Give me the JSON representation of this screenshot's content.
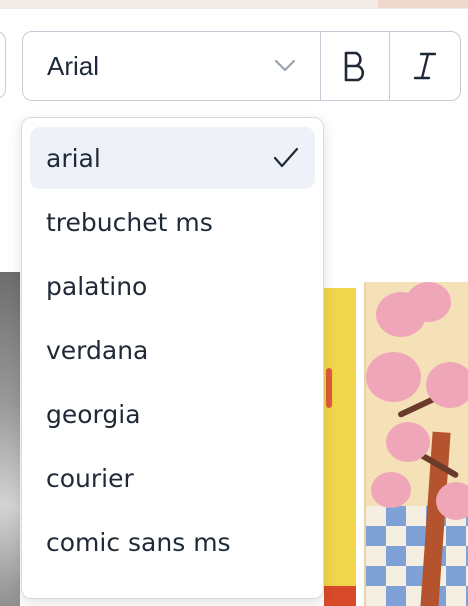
{
  "toolbar": {
    "font_select_value": "Arial",
    "bold_icon": "bold-icon",
    "italic_icon": "italic-icon",
    "chevron_icon": "chevron-down-icon"
  },
  "dropdown": {
    "options": [
      {
        "label": "arial",
        "selected": true
      },
      {
        "label": "trebuchet ms",
        "selected": false
      },
      {
        "label": "palatino",
        "selected": false
      },
      {
        "label": "verdana",
        "selected": false
      },
      {
        "label": "georgia",
        "selected": false
      },
      {
        "label": "courier",
        "selected": false
      },
      {
        "label": "comic sans ms",
        "selected": false
      }
    ],
    "check_icon": "check-icon"
  },
  "colors": {
    "border": "#c4ccd8",
    "selected_bg": "#eef2f8",
    "text": "#1f2937"
  }
}
